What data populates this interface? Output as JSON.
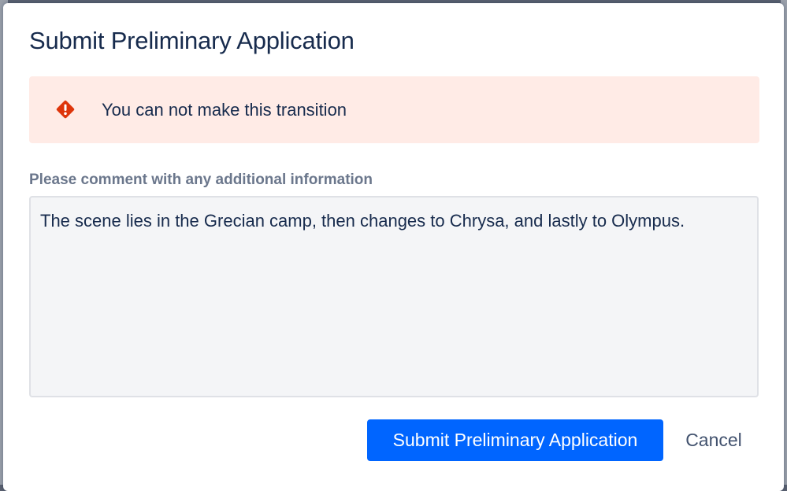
{
  "dialog": {
    "title": "Submit Preliminary Application"
  },
  "error_banner": {
    "icon": "error-icon",
    "message": "You can not make this transition",
    "background_color": "#ffebe6",
    "icon_color": "#de350b"
  },
  "comment": {
    "label": "Please comment with any additional information",
    "value": "The scene lies in the Grecian camp, then changes to Chrysa, and lastly to Olympus."
  },
  "actions": {
    "submit_label": "Submit Preliminary Application",
    "cancel_label": "Cancel",
    "primary_color": "#0065ff"
  }
}
